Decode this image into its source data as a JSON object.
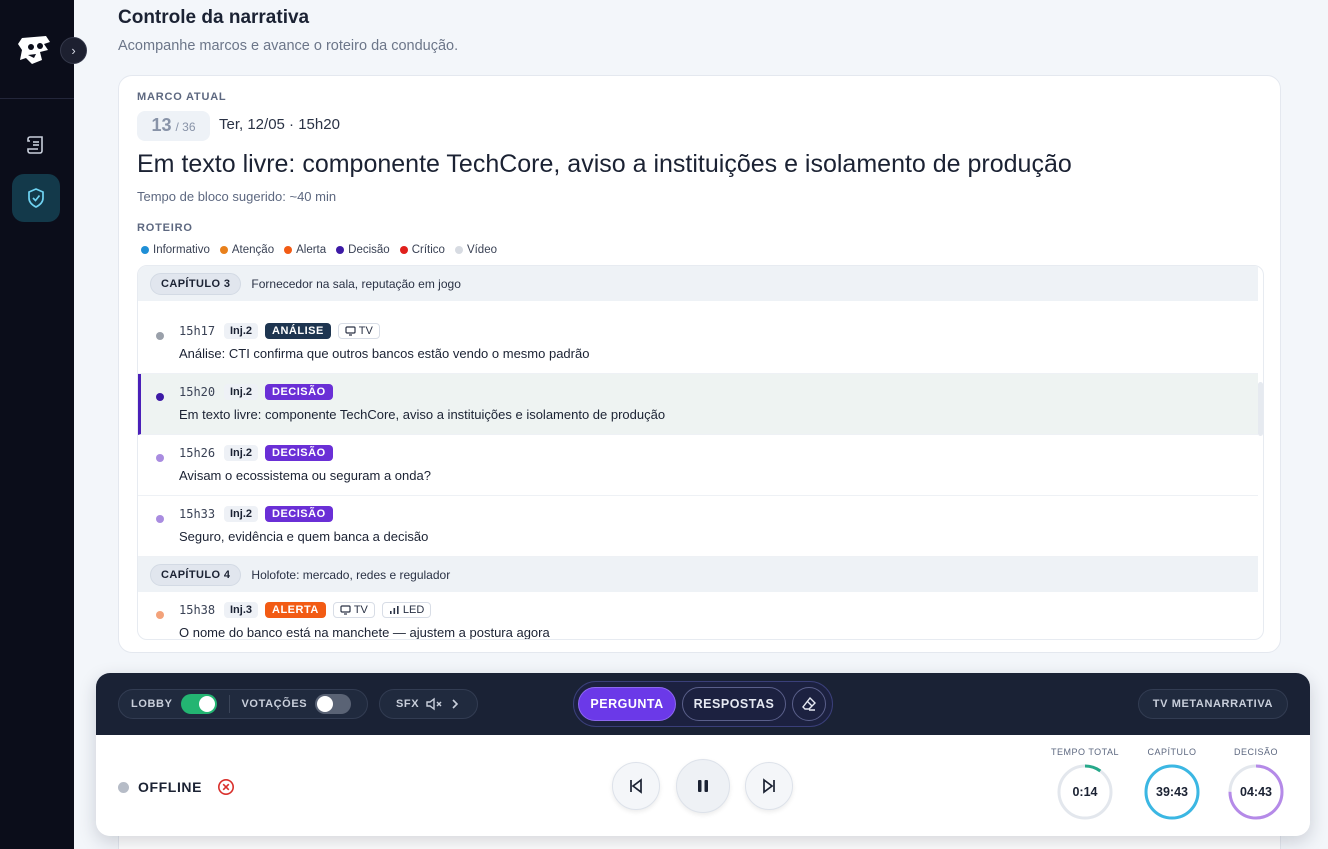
{
  "header": {
    "title": "Controle da narrativa",
    "subtitle": "Acompanhe marcos e avance o roteiro da condução."
  },
  "milestone": {
    "kicker": "MARCO ATUAL",
    "index": "13",
    "total": "/ 36",
    "datetime": "Ter, 12/05 · 15h20",
    "title": "Em texto livre: componente TechCore, aviso a instituições e isolamento de produção",
    "block_time": "Tempo de bloco sugerido: ~40 min"
  },
  "script": {
    "kicker": "ROTEIRO",
    "legend": [
      {
        "label": "Informativo",
        "color": "#1f8fd6"
      },
      {
        "label": "Atenção",
        "color": "#e8801c"
      },
      {
        "label": "Alerta",
        "color": "#f25b14"
      },
      {
        "label": "Decisão",
        "color": "#3d1aa6"
      },
      {
        "label": "Crítico",
        "color": "#e0201c"
      },
      {
        "label": "Vídeo",
        "color": "#d7dbe2"
      }
    ],
    "chapter3": {
      "chip": "CAPÍTULO 3",
      "desc": "Fornecedor na sala, reputação em jogo"
    },
    "chapter4": {
      "chip": "CAPÍTULO 4",
      "desc": "Holofote: mercado, redes e regulador"
    },
    "rows": [
      {
        "time": "15h17",
        "inj": "Inj.2",
        "tag": "ANÁLISE",
        "extra1": "TV",
        "text": "Análise: CTI confirma que outros bancos estão vendo o mesmo padrão",
        "bullet": "#9aa0aa"
      },
      {
        "time": "15h20",
        "inj": "Inj.2",
        "tag": "DECISÃO",
        "text": "Em texto livre: componente TechCore, aviso a instituições e isolamento de produção",
        "bullet": "#3d1aa6"
      },
      {
        "time": "15h26",
        "inj": "Inj.2",
        "tag": "DECISÃO",
        "text": "Avisam o ecossistema ou seguram a onda?",
        "bullet": "#a98ce0"
      },
      {
        "time": "15h33",
        "inj": "Inj.2",
        "tag": "DECISÃO",
        "text": "Seguro, evidência e quem banca a decisão",
        "bullet": "#a98ce0"
      },
      {
        "time": "15h38",
        "inj": "Inj.3",
        "tag": "ALERTA",
        "extra1": "TV",
        "extra2": "LED",
        "text": "O nome do banco está na manchete — ajustem a postura agora",
        "bullet": "#f3a27a"
      }
    ]
  },
  "controls": {
    "lobby_label": "LOBBY",
    "lobby_on": true,
    "votacoes_label": "VOTAÇÕES",
    "votacoes_on": false,
    "sfx_label": "SFX",
    "mode_pergunta": "PERGUNTA",
    "mode_respostas": "RESPOSTAS",
    "tv_label": "TV METANARRATIVA",
    "status_label": "OFFLINE",
    "timers": [
      {
        "caption": "TEMPO TOTAL",
        "value": "0:14",
        "progress": 0.1,
        "color": "#27a98a"
      },
      {
        "caption": "CAPÍTULO",
        "value": "39:43",
        "progress": 1.0,
        "color": "#3bb7e3"
      },
      {
        "caption": "DECISÃO",
        "value": "04:43",
        "progress": 0.75,
        "color": "#b58ae8"
      }
    ]
  }
}
